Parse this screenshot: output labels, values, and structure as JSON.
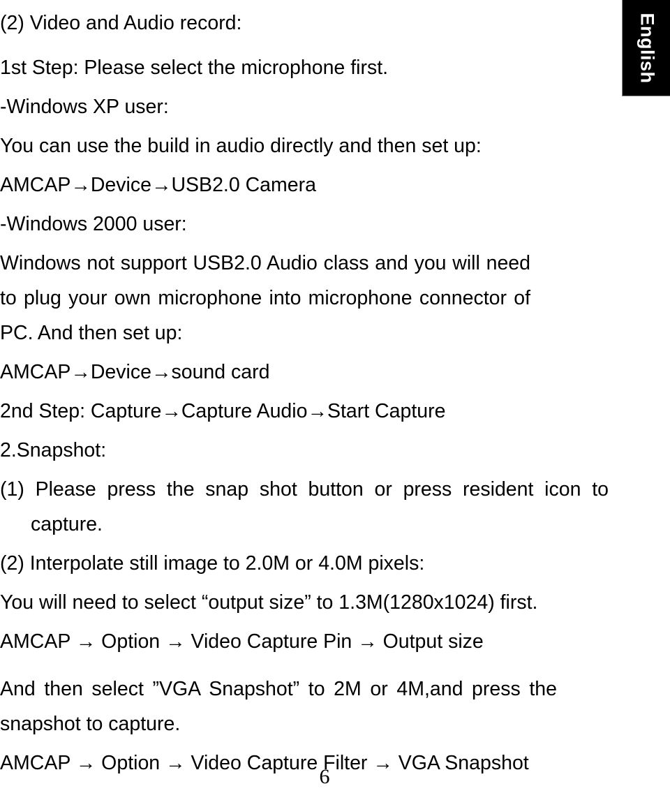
{
  "language_tab": {
    "label": "English",
    "background": "#000000",
    "text_color": "#ffffff"
  },
  "document": {
    "page_number": "6",
    "heading": "(2) Video and Audio record:",
    "lines": {
      "step1": "1st Step: Please select the microphone first.",
      "xp_user": "-Windows XP user:",
      "xp_detail": "You can use the build in audio directly and then set up:",
      "xp_path": "AMCAP→Device→USB2.0 Camera",
      "w2000_user": "-Windows 2000 user:",
      "w2000_detail": "Windows not support USB2.0 Audio class and you will need to plug your own microphone into microphone connector of PC. And then set up:",
      "w2000_path": "AMCAP→Device→sound card",
      "step2": "2nd Step: Capture→Capture Audio→Start Capture",
      "snapshot_heading": "2.Snapshot:",
      "snapshot_item_1": "(1) Please press the snap shot button or press resident icon to capture.",
      "snapshot_item_2": "(2) Interpolate still image to 2.0M or 4.0M pixels:",
      "output_size_note": "You will need to select “output size” to 1.3M(1280x1024) first.",
      "output_size_path": "AMCAP → Option → Video Capture Pin → Output size",
      "vga_note": "And then select ”VGA Snapshot” to 2M or 4M,and press the snapshot to capture.",
      "vga_path": "AMCAP → Option → Video Capture Filter → VGA Snapshot"
    }
  }
}
